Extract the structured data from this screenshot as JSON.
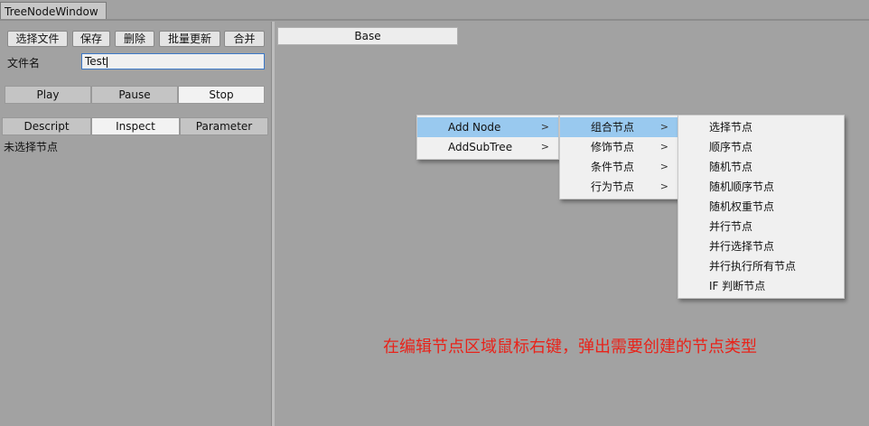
{
  "window": {
    "tab_title": "TreeNodeWindow"
  },
  "toolbar": {
    "select_file": "选择文件",
    "save": "保存",
    "delete": "删除",
    "batch_update": "批量更新",
    "merge": "合并"
  },
  "file": {
    "label": "文件名",
    "value": "Test"
  },
  "playback": {
    "play": "Play",
    "pause": "Pause",
    "stop": "Stop"
  },
  "inspector_tabs": {
    "descript": "Descript",
    "inspect": "Inspect",
    "parameter": "Parameter"
  },
  "status": {
    "no_selection": "未选择节点"
  },
  "canvas": {
    "base_label": "Base"
  },
  "context_menu": {
    "items": [
      "Add Node",
      "AddSubTree"
    ],
    "submenu": [
      "组合节点",
      "修饰节点",
      "条件节点",
      "行为节点"
    ],
    "composite": [
      "选择节点",
      "顺序节点",
      "随机节点",
      "随机顺序节点",
      "随机权重节点",
      "并行节点",
      "并行选择节点",
      "并行执行所有节点",
      "IF 判断节点"
    ]
  },
  "annotation": "在编辑节点区域鼠标右键，弹出需要创建的节点类型",
  "colors": {
    "highlight": "#99c9ef",
    "annotation": "#e8231a",
    "panel_bg": "#a2a2a2"
  }
}
